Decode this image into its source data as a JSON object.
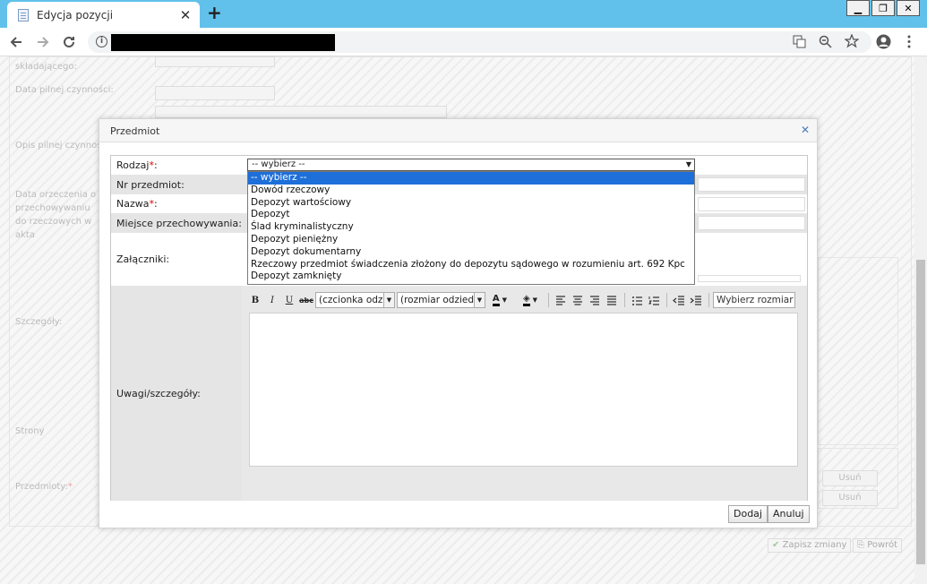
{
  "browser": {
    "tab_title": "Edycja pozycji",
    "tab_close": "✕",
    "new_tab": "+",
    "win_minimize": "▁",
    "win_restore": "❐",
    "win_close": "✕"
  },
  "background_form": {
    "labels": {
      "skladajacego": "składającego:",
      "data_pilnej": "Data pilnej czynności:",
      "opis_pilnej": "Opis pilnej czynnoś",
      "data_orzeczenia": "Data orzeczenia o przechowywaniu do rzeczowych w akta",
      "szczegoly": "Szczegóły:",
      "strony": "Strony",
      "przedmioty": "Przedmioty:"
    },
    "usun_label": "Usuń",
    "zapisz_label": "Zapisz zmiany",
    "powrot_label": "Powrót"
  },
  "modal": {
    "title": "Przedmiot",
    "close": "✕",
    "fields": {
      "rodzaj": "Rodzaj",
      "nr_przedmiot": "Nr przedmiot:",
      "nazwa": "Nazwa",
      "miejsce": "Miejsce przechowywania:",
      "zalaczniki": "Załączniki:",
      "uwagi": "Uwagi/szczegóły:"
    },
    "required_mark": "*",
    "colon": ":",
    "select": {
      "value": "-- wybierz --",
      "options": [
        "-- wybierz --",
        "Dowód rzeczowy",
        "Depozyt wartościowy",
        "Depozyt",
        "Ślad kryminalistyczny",
        "Depozyt pieniężny",
        "Depozyt dokumentarny",
        "Rzeczowy przedmiot świadczenia złożony do depozytu sądowego w rozumieniu art. 692 Kpc",
        "Depozyt zamknięty"
      ],
      "selected_index": 0
    },
    "editor": {
      "bold": "B",
      "italic": "I",
      "underline": "U",
      "strike": "abc",
      "font_combo": "(czcionka odz",
      "size_combo": "(rozmiar odzied",
      "size_select": "Wybierz rozmiar"
    },
    "buttons": {
      "add": "Dodaj",
      "cancel": "Anuluj"
    }
  }
}
